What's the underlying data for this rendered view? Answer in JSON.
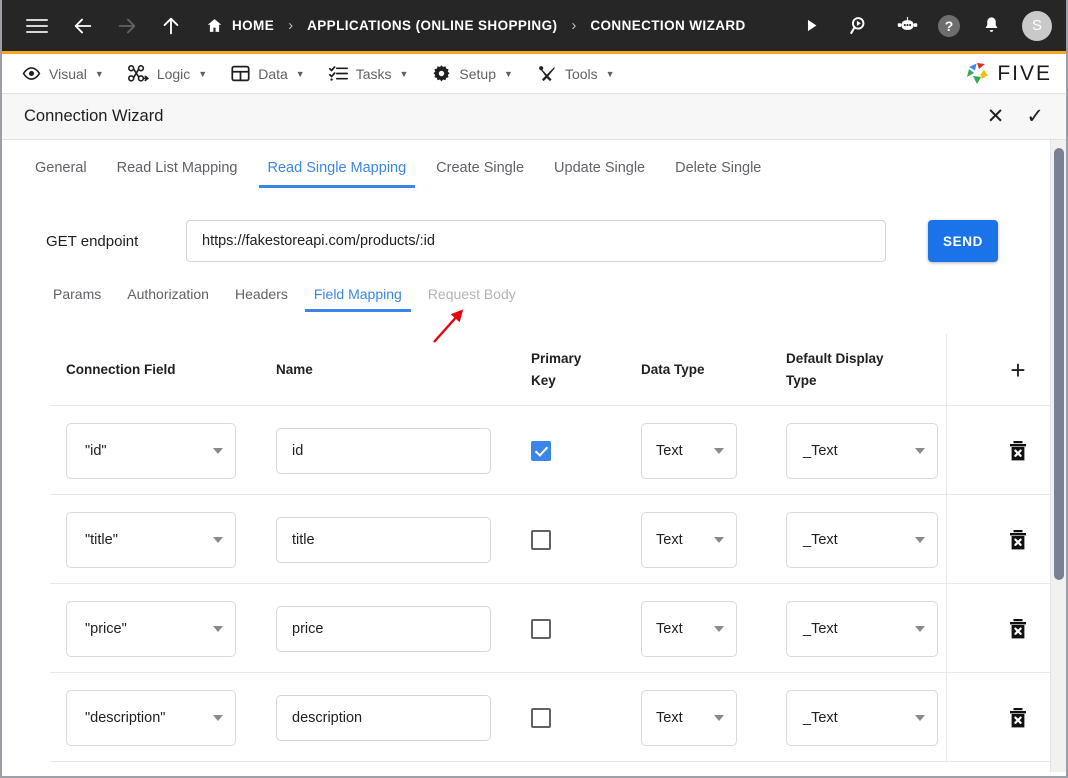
{
  "topbar": {
    "menu_icon": "hamburger-icon",
    "back_icon": "arrow-left-icon",
    "forward_icon": "arrow-right-icon",
    "up_icon": "arrow-up-icon",
    "home_icon": "home-icon",
    "breadcrumbs": [
      {
        "label": "HOME",
        "icon": "home-icon"
      },
      {
        "label": "APPLICATIONS (ONLINE SHOPPING)"
      },
      {
        "label": "CONNECTION WIZARD"
      }
    ],
    "separator": "›",
    "actions": [
      {
        "name": "run-icon",
        "glyph": "▶"
      },
      {
        "name": "search-play-icon",
        "glyph": "search"
      },
      {
        "name": "chat-bot-icon",
        "glyph": "bot"
      },
      {
        "name": "help-icon",
        "glyph": "?"
      },
      {
        "name": "notifications-bell-icon",
        "glyph": "bell"
      }
    ],
    "avatar_initial": "S",
    "accent_color": "#f5a623",
    "background_color": "#262626"
  },
  "menubar": {
    "items": [
      {
        "label": "Visual",
        "icon": "eye-icon",
        "caret": "▼"
      },
      {
        "label": "Logic",
        "icon": "flow-nodes-icon",
        "caret": "▼"
      },
      {
        "label": "Data",
        "icon": "table-grid-icon",
        "caret": "▼"
      },
      {
        "label": "Tasks",
        "icon": "checklist-icon",
        "caret": "▼"
      },
      {
        "label": "Setup",
        "icon": "gear-icon",
        "caret": "▼"
      },
      {
        "label": "Tools",
        "icon": "tools-cross-icon",
        "caret": "▼"
      }
    ],
    "brand": "FIVE"
  },
  "wizard": {
    "title": "Connection Wizard",
    "close_glyph": "✕",
    "confirm_glyph": "✓",
    "tabs": [
      {
        "label": "General",
        "active": false
      },
      {
        "label": "Read List Mapping",
        "active": false
      },
      {
        "label": "Read Single Mapping",
        "active": true
      },
      {
        "label": "Create Single",
        "active": false
      },
      {
        "label": "Update Single",
        "active": false
      },
      {
        "label": "Delete Single",
        "active": false
      }
    ],
    "active_tab_color": "#3a86e8"
  },
  "annotation": {
    "arrow_color": "#e8000d",
    "points_at": "Create Single"
  },
  "endpoint": {
    "label": "GET endpoint",
    "value": "https://fakestoreapi.com/products/:id",
    "placeholder": "",
    "send_label": "SEND",
    "send_color": "#1a73e8"
  },
  "subtabs": [
    {
      "label": "Params",
      "active": false,
      "disabled": false
    },
    {
      "label": "Authorization",
      "active": false,
      "disabled": false
    },
    {
      "label": "Headers",
      "active": false,
      "disabled": false
    },
    {
      "label": "Field Mapping",
      "active": true,
      "disabled": false
    },
    {
      "label": "Request Body",
      "active": false,
      "disabled": true
    }
  ],
  "mapping_table": {
    "headers": {
      "connection_field": "Connection Field",
      "name": "Name",
      "primary_key": "Primary Key",
      "data_type": "Data Type",
      "default_display_type": "Default Display Type",
      "add_label": "+"
    },
    "rows": [
      {
        "connection_field": "\"id\"",
        "name": "id",
        "primary_key": true,
        "data_type": "Text",
        "default_display_type": "_Text",
        "delete_icon": "trash-icon"
      },
      {
        "connection_field": "\"title\"",
        "name": "title",
        "primary_key": false,
        "data_type": "Text",
        "default_display_type": "_Text",
        "delete_icon": "trash-icon"
      },
      {
        "connection_field": "\"price\"",
        "name": "price",
        "primary_key": false,
        "data_type": "Text",
        "default_display_type": "_Text",
        "delete_icon": "trash-icon"
      },
      {
        "connection_field": "\"description\"",
        "name": "description",
        "primary_key": false,
        "data_type": "Text",
        "default_display_type": "_Text",
        "delete_icon": "trash-icon"
      }
    ]
  }
}
